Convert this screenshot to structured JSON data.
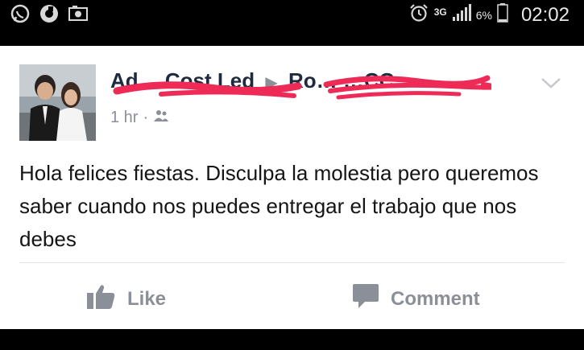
{
  "status_bar": {
    "time": "02:02",
    "battery_percent": "6%",
    "network": "3G",
    "icons": [
      "whatsapp-icon",
      "app-icon",
      "photo-icon",
      "alarm-icon",
      "signal-icon",
      "battery-icon"
    ]
  },
  "post": {
    "author": "Ad… Cost Led",
    "recipient": "Ro… …CC",
    "time": "1 hr",
    "separator": "·",
    "audience_icon": "friends-icon",
    "text": "Hola felices fiestas. Disculpa la molestia pero queremos saber cuando nos puedes entregar el trabajo que nos debes",
    "menu_icon": "chevron-down-icon"
  },
  "actions": {
    "like_label": "Like",
    "comment_label": "Comment"
  },
  "colors": {
    "redaction": "#ee2a57",
    "author": "#1d2a3f",
    "meta": "#8b8f97"
  }
}
